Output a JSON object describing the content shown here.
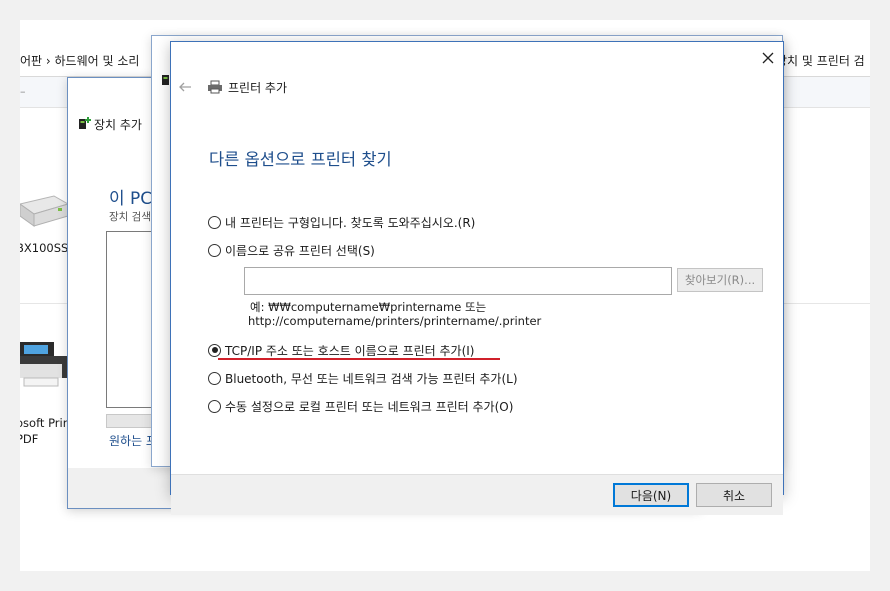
{
  "explorer": {
    "breadcrumb_left": "어판  ›  하드웨어 및 소리",
    "breadcrumb_right": "장치 및 프린터 검",
    "device_1_label": "BX100SS",
    "device_2_label_line1": "osoft Prin",
    "device_2_label_line2": "PDF"
  },
  "add_device_window": {
    "title": "장치 추가",
    "heading": "이 PC",
    "subtext": "장치 검색",
    "link": "원하는 프"
  },
  "dialog": {
    "title": "프린터 추가",
    "heading": "다른 옵션으로 프린터 찾기",
    "options": [
      {
        "label": "내 프린터는 구형입니다. 찾도록 도와주십시오.(R)",
        "selected": false
      },
      {
        "label": "이름으로 공유 프린터 선택(S)",
        "selected": false
      },
      {
        "label": "TCP/IP 주소 또는 호스트 이름으로 프린터 추가(I)",
        "selected": true
      },
      {
        "label": "Bluetooth, 무선 또는 네트워크 검색 가능 프린터 추가(L)",
        "selected": false
      },
      {
        "label": "수동 설정으로 로컬 프린터 또는 네트워크 프린터 추가(O)",
        "selected": false
      }
    ],
    "shared_printer_input_value": "",
    "browse_label": "찾아보기(R)...",
    "example_line1": "예: ₩₩computername₩printername 또는",
    "example_line2": "http://computername/printers/printername/.printer",
    "next_label": "다음(N)",
    "cancel_label": "취소"
  },
  "colors": {
    "heading_blue": "#1e4e8c",
    "highlight_red": "#d0202a",
    "default_button_border": "#0078d7"
  }
}
